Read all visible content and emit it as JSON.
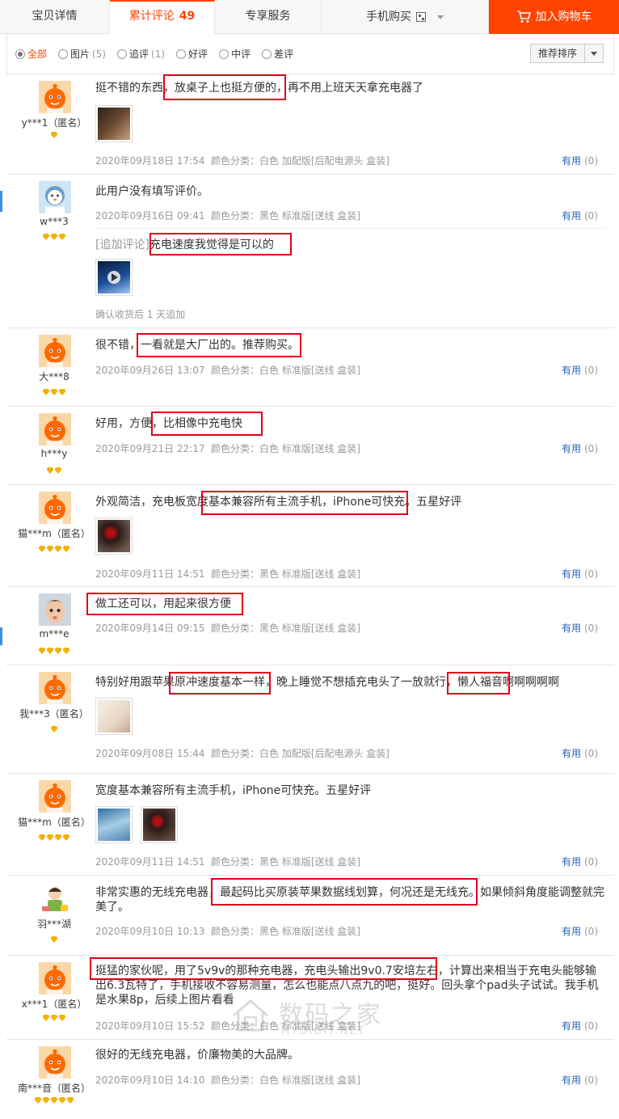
{
  "tabs": {
    "details": "宝贝详情",
    "reviews_label": "累计评论",
    "reviews_count": "49",
    "service": "专享服务",
    "mobile": "手机购买",
    "cart": "加入购物车"
  },
  "filters": {
    "all": "全部",
    "pics": "图片",
    "pics_count": "(5)",
    "follow": "追评",
    "follow_count": "(1)",
    "good": "好评",
    "mid": "中评",
    "bad": "差评",
    "sort": "推荐排序"
  },
  "useful_label": "有用",
  "useful_count": "(0)",
  "reviews": [
    {
      "user": "y***1（匿名）",
      "content": "挺不错的东西，放桌子上也挺方便的，再不用上班天天拿充电器了",
      "date": "2020年09月18日 17:54",
      "sku": "颜色分类：白色 加配版[后配电源头 盒装]"
    },
    {
      "user": "w***3",
      "content": "此用户没有填写评价。",
      "date": "2020年09月16日 09:41",
      "sku": "颜色分类：黑色 标准版[送线 盒装]",
      "append_tag": "[追加评论]",
      "append_text": "充电速度我觉得是可以的",
      "append_note": "确认收货后 1 天追加"
    },
    {
      "user": "大***8",
      "content": "很不错，一看就是大厂出的。推荐购买。",
      "date": "2020年09月26日 13:07",
      "sku": "颜色分类：白色 标准版[送线 盒装]"
    },
    {
      "user": "h***y",
      "content": "好用，方便，比相像中充电快",
      "date": "2020年09月21日 22:17",
      "sku": "颜色分类：白色 标准版[送线 盒装]"
    },
    {
      "user": "猫***m（匿名）",
      "content": "外观简洁，充电板宽度基本兼容所有主流手机，iPhone可快充。五星好评",
      "date": "2020年09月11日 14:51",
      "sku": "颜色分类：黑色 标准版[送线 盒装]"
    },
    {
      "user": "m***e",
      "content": "做工还可以，用起来很方便",
      "date": "2020年09月14日 09:15",
      "sku": "颜色分类：黑色 标准版[送线 盒装]"
    },
    {
      "user": "我***3（匿名）",
      "content": "特别好用跟苹果原冲速度基本一样，晚上睡觉不想插充电头了一放就行，懒人福音啊啊啊啊啊",
      "date": "2020年09月08日 15:44",
      "sku": "颜色分类：白色 加配版[后配电源头 盒装]"
    },
    {
      "user": "猫***m（匿名）",
      "content": "宽度基本兼容所有主流手机，iPhone可快充。五星好评",
      "date": "2020年09月11日 14:51",
      "sku": "颜色分类：黑色 标准版[送线 盒装]"
    },
    {
      "user": "羽***湖",
      "content": "非常实惠的无线充电器，最起码比买原装苹果数据线划算，何况还是无线充。如果倾斜角度能调整就完美了。",
      "date": "2020年09月10日 10:13",
      "sku": "颜色分类：黑色 标准版[送线 盒装]"
    },
    {
      "user": "x***1（匿名）",
      "content": "挺猛的家伙呢，用了5v9v的那种充电器，充电头输出9v0.7安培左右，计算出来相当于充电头能够输出6.3瓦特了，手机接收不容易测量，怎么也能点八点九的吧，挺好。回头拿个pad头子试试。我手机是水果8p，后续上图片看看",
      "date": "2020年09月10日 15:52",
      "sku": "颜色分类：白色 标准版[送线 盒装]"
    },
    {
      "user": "南***音（匿名）",
      "content": "很好的无线充电器，价廉物美的大品牌。",
      "date": "2020年09月10日 14:10",
      "sku": "颜色分类：白色 标准版[送线 盒装]"
    }
  ],
  "watermark": {
    "cn": "数码之家",
    "en": "MYDIGIT.NET"
  },
  "colors": {
    "accent": "#ff4400",
    "link": "#2763b6",
    "highlight": "#e0001b",
    "diamond": "#f2b200"
  }
}
